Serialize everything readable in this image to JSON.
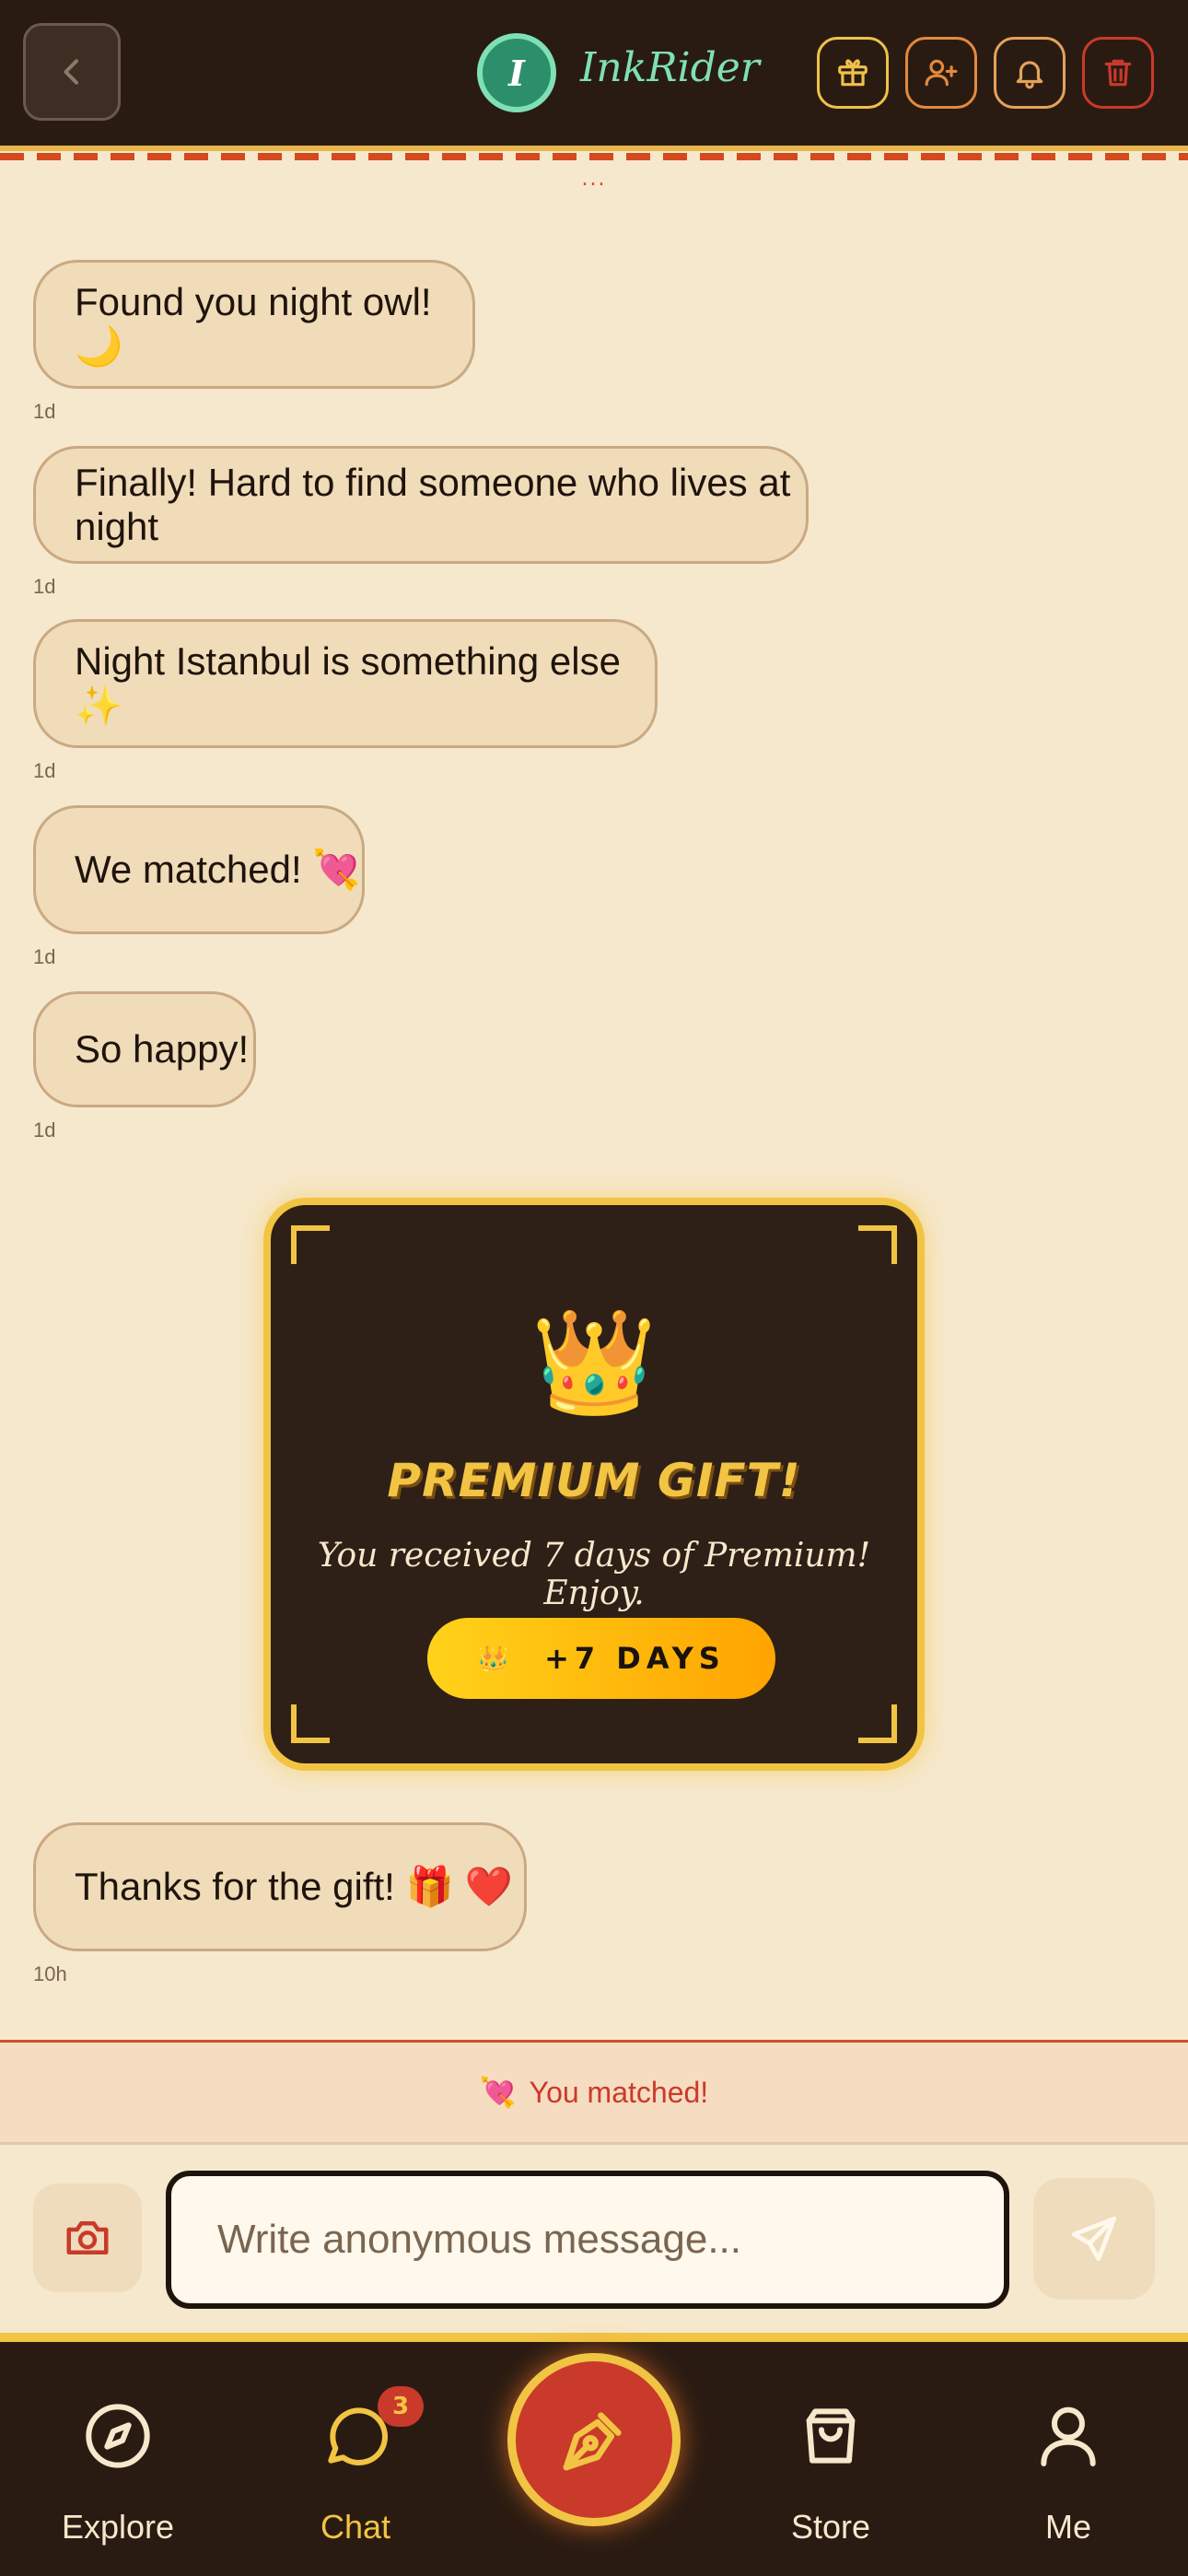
{
  "header": {
    "avatar_initial": "I",
    "username": "InkRider",
    "icons": [
      "back-icon",
      "gift-icon",
      "add-friend-icon",
      "bell-icon",
      "trash-icon"
    ]
  },
  "typing_indicator": "...",
  "messages": [
    {
      "text": "Found you night owl! 🌙",
      "time": "1d"
    },
    {
      "text": "Finally! Hard to find someone who lives at night",
      "time": "1d"
    },
    {
      "text": "Night Istanbul is something else ✨",
      "time": "1d"
    },
    {
      "text": "We matched! 💘",
      "time": "1d"
    },
    {
      "text": "So happy!",
      "time": "1d"
    },
    {
      "text": "Thanks for the gift! 🎁 ❤️",
      "time": "10h"
    }
  ],
  "premium_card": {
    "icon": "👑",
    "title": "PREMIUM GIFT!",
    "subtitle": "You received 7 days of Premium! Enjoy.",
    "badge_icon": "👑",
    "badge_text": "+7 DAYS"
  },
  "match_banner": {
    "icon": "💘",
    "text": "You matched!"
  },
  "composer": {
    "placeholder": "Write anonymous message..."
  },
  "nav": {
    "items": [
      {
        "label": "Explore"
      },
      {
        "label": "Chat",
        "badge": "3"
      },
      {
        "label": "Store"
      },
      {
        "label": "Me"
      }
    ]
  },
  "colors": {
    "background": "#f6e8cc",
    "header": "#2a1b12",
    "accent_gold": "#f2c443",
    "accent_red": "#c93a2a",
    "accent_green": "#7fe0b6"
  }
}
